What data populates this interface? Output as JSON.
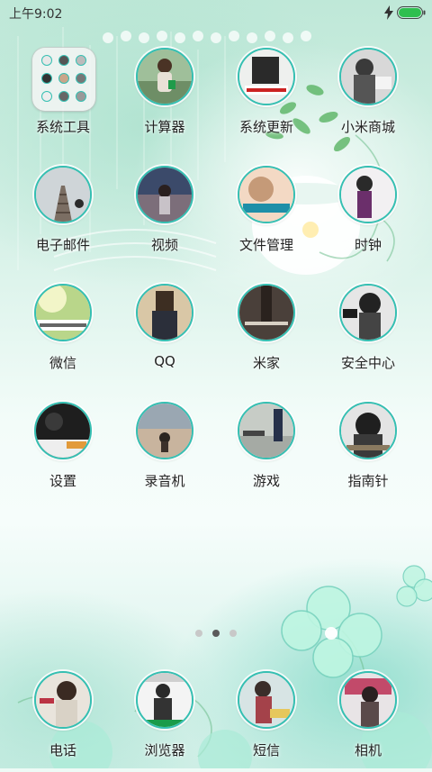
{
  "status_bar": {
    "time": "上午9:02",
    "battery_color": "#2fbf4f"
  },
  "colors": {
    "icon_ring": "#35bfb2",
    "label_text": "#222222"
  },
  "home_screen": {
    "apps": [
      {
        "label": "系统工具",
        "type": "folder",
        "icon": "folder-icon"
      },
      {
        "label": "计算器",
        "icon": "calculator-icon"
      },
      {
        "label": "系统更新",
        "icon": "system-update-icon"
      },
      {
        "label": "小米商城",
        "icon": "mi-store-icon"
      },
      {
        "label": "电子邮件",
        "icon": "email-icon"
      },
      {
        "label": "视频",
        "icon": "video-icon"
      },
      {
        "label": "文件管理",
        "icon": "file-manager-icon"
      },
      {
        "label": "时钟",
        "icon": "clock-icon"
      },
      {
        "label": "微信",
        "icon": "wechat-icon"
      },
      {
        "label": "QQ",
        "icon": "qq-icon"
      },
      {
        "label": "米家",
        "icon": "mijia-icon"
      },
      {
        "label": "安全中心",
        "icon": "security-center-icon"
      },
      {
        "label": "设置",
        "icon": "settings-icon"
      },
      {
        "label": "录音机",
        "icon": "recorder-icon"
      },
      {
        "label": "游戏",
        "icon": "games-icon"
      },
      {
        "label": "指南针",
        "icon": "compass-icon"
      }
    ],
    "page_indicator": {
      "pages": 3,
      "current": 2
    }
  },
  "dock": {
    "apps": [
      {
        "label": "电话",
        "icon": "phone-icon"
      },
      {
        "label": "浏览器",
        "icon": "browser-icon"
      },
      {
        "label": "短信",
        "icon": "messages-icon"
      },
      {
        "label": "相机",
        "icon": "camera-icon"
      }
    ]
  }
}
